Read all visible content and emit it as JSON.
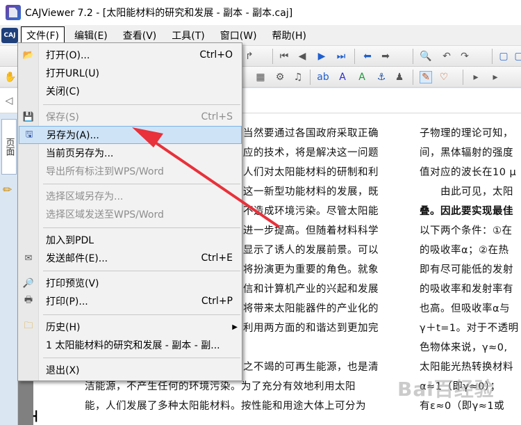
{
  "window": {
    "title": "CAJViewer 7.2 - [太阳能材料的研究和发展 - 副本 - 副本.caj]"
  },
  "menubar": {
    "logo_text": "CAJ",
    "items": [
      "文件(F)",
      "编辑(E)",
      "查看(V)",
      "工具(T)",
      "窗口(W)",
      "帮助(H)"
    ]
  },
  "sidebar": {
    "tab_label": "页面"
  },
  "file_menu": {
    "items": [
      {
        "label": "打开(O)...",
        "shortcut": "Ctrl+O",
        "icon": "folder-open-icon",
        "disabled": false
      },
      {
        "label": "打开URL(U)",
        "shortcut": "",
        "icon": "",
        "disabled": false
      },
      {
        "label": "关闭(C)",
        "shortcut": "",
        "icon": "",
        "disabled": false
      },
      {
        "label": "保存(S)",
        "shortcut": "Ctrl+S",
        "icon": "save-icon",
        "disabled": true
      },
      {
        "label": "另存为(A)...",
        "shortcut": "",
        "icon": "save-as-icon",
        "disabled": false
      },
      {
        "label": "当前页另存为...",
        "shortcut": "",
        "icon": "",
        "disabled": false
      },
      {
        "label": "导出所有标注到WPS/Word",
        "shortcut": "",
        "icon": "",
        "disabled": true
      },
      {
        "label": "选择区域另存为...",
        "shortcut": "",
        "icon": "",
        "disabled": true
      },
      {
        "label": "选择区域发送至WPS/Word",
        "shortcut": "",
        "icon": "",
        "disabled": true
      },
      {
        "label": "加入到PDL",
        "shortcut": "",
        "icon": "",
        "disabled": false
      },
      {
        "label": "发送邮件(E)...",
        "shortcut": "Ctrl+E",
        "icon": "mail-icon",
        "disabled": false
      },
      {
        "label": "打印预览(V)",
        "shortcut": "",
        "icon": "print-preview-icon",
        "disabled": false
      },
      {
        "label": "打印(P)...",
        "shortcut": "Ctrl+P",
        "icon": "printer-icon",
        "disabled": false
      },
      {
        "label": "历史(H)",
        "shortcut": "",
        "icon": "history-folder-icon",
        "disabled": false
      },
      {
        "label": "1 太阳能材料的研究和发展 - 副本 - 副...",
        "shortcut": "",
        "icon": "",
        "disabled": false
      },
      {
        "label": "退出(X)",
        "shortcut": "",
        "icon": "",
        "disabled": false
      }
    ]
  },
  "document": {
    "col1": [
      "当然要通过各国政府采取正确",
      "应的技术，将是解决这一问题",
      "人们对太阳能材料的研制和利",
      "这一新型功能材料的发展，既",
      "不造成环境污染。尽管太阳能",
      "进一步提高。但随着材料科学",
      "显示了诱人的发展前景。可以",
      "将扮演更为重要的角色。就象",
      "信和计算机产业的兴起和发展",
      "将带来太阳能器件的产业化的",
      "利用两方面的和谐达到更加完",
      "",
      "之不竭的可再生能源，也是清"
    ],
    "bottom_lines": [
      "洁能源，不产生任何的环境污染。为了充分有效地利用太阳",
      "能，人们发展了多种太阳能材料。按性能和用途大体上可分为"
    ],
    "col2": [
      "子物理的理论可知，",
      "间，黑体辐射的强度",
      "值对应的波长在10 μ",
      "　　由此可见，太阳",
      "叠。因此要实现最佳",
      "以下两个条件：①在",
      "的吸收率α；②在热",
      "即有尽可能低的发射",
      "的吸收率和发射率有",
      "也高。但吸收率α与",
      "γ＋t=1。对于不透明",
      "色物体来说，γ≈0,",
      "太阳能光热转换材料",
      "α≈1（即γ≈0）；",
      "有ε≈0（即γ≈1或"
    ]
  },
  "watermark": {
    "text": "Bai百经验"
  },
  "colors": {
    "highlight_bg": "#cfe3f7",
    "highlight_border": "#7ab3e6",
    "annotation_arrow": "#e8313a"
  }
}
